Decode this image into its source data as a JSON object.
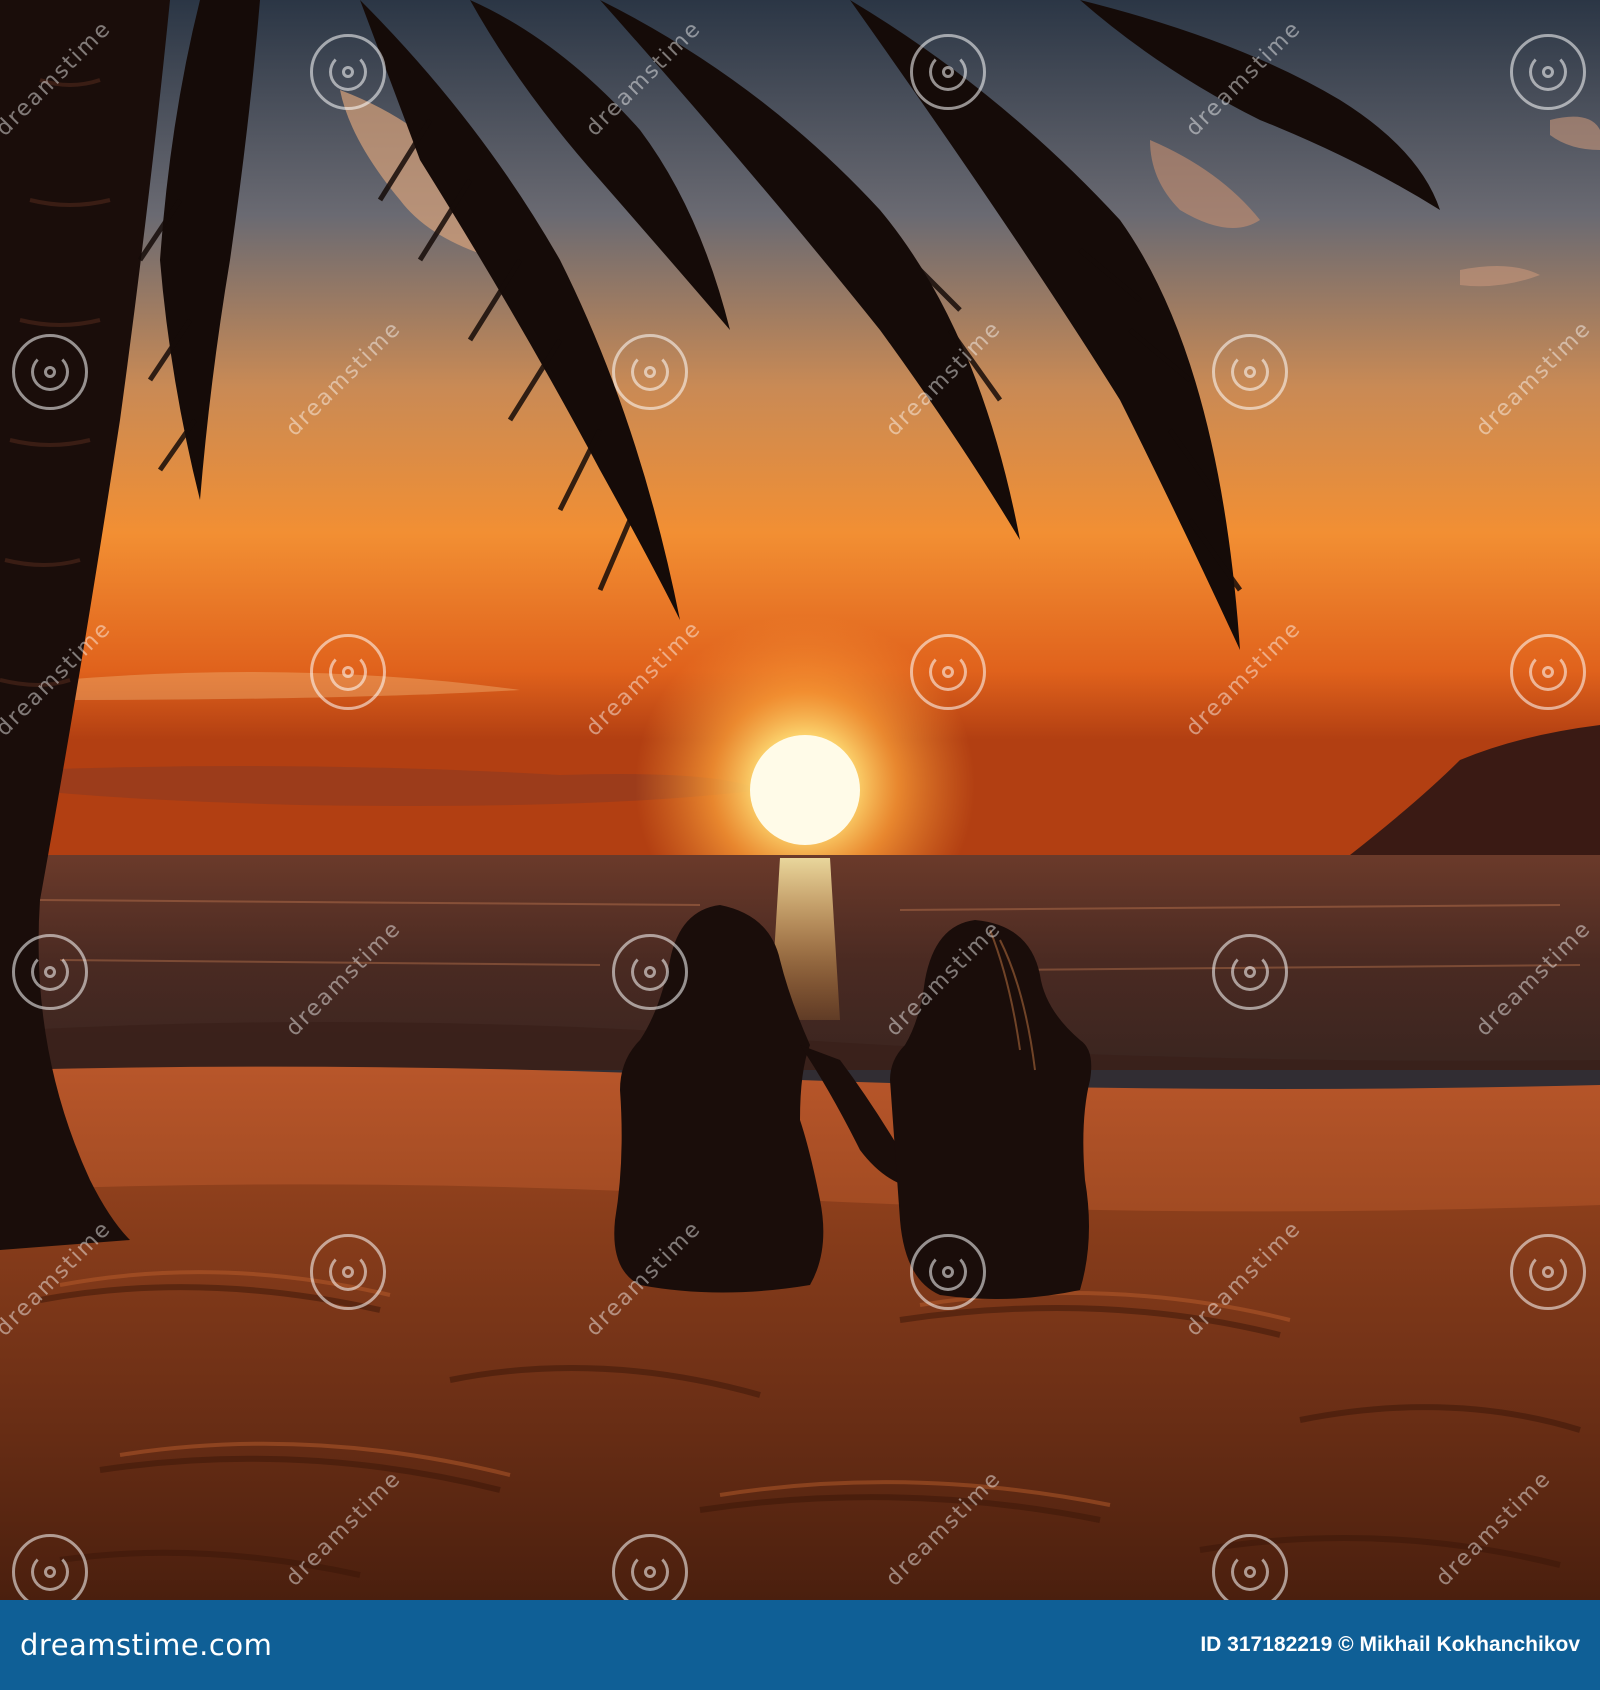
{
  "footer": {
    "brand_url": "dreamstime.com",
    "image_id": "ID 317182219",
    "copyright": "© Mikhail Kokhanchikov"
  },
  "watermark": {
    "text": "dreamstime"
  },
  "colors": {
    "footer_bar": "#0f5f96",
    "sky_top": "#2b3a4a",
    "sky_horizon": "#f08a2a",
    "sun": "#fff6d0",
    "silhouette": "#1a0d0a",
    "sand": "#8a3e1c"
  }
}
